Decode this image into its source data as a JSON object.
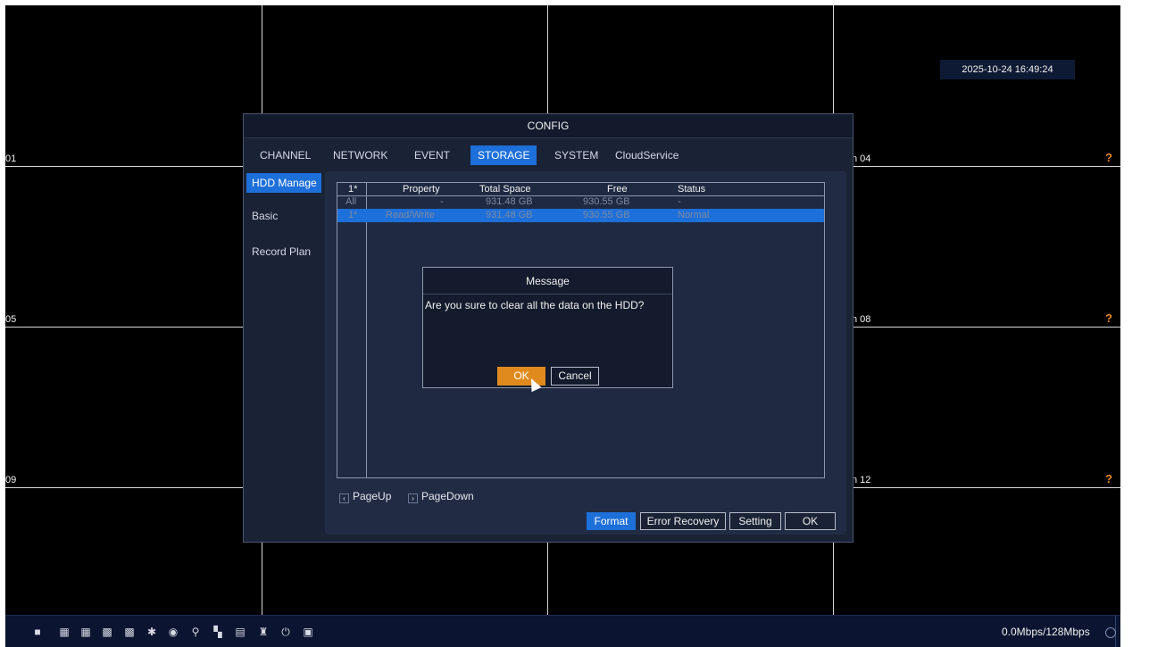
{
  "screen": {
    "clock": "2025-10-24 16:49:24",
    "cameras": [
      {
        "label": "01",
        "status": ""
      },
      {
        "label": "n 04",
        "status": "?"
      },
      {
        "label": "05",
        "status": ""
      },
      {
        "label": "n 08",
        "status": "?"
      },
      {
        "label": "09",
        "status": ""
      },
      {
        "label": "n 12",
        "status": "?"
      }
    ]
  },
  "config": {
    "title": "CONFIG",
    "tabs": [
      "CHANNEL",
      "NETWORK",
      "EVENT",
      "STORAGE",
      "SYSTEM",
      "CloudService"
    ],
    "active_tab": "STORAGE",
    "sidebar": [
      "HDD Manage",
      "Basic",
      "Record Plan"
    ],
    "active_sidebar": "HDD Manage",
    "table": {
      "headers": [
        "1*",
        "Property",
        "Total Space",
        "Free",
        "Status"
      ],
      "rows": [
        [
          "All",
          "-",
          "931.48 GB",
          "930.55 GB",
          "-"
        ],
        [
          "1*",
          "Read/Write",
          "931.48 GB",
          "930.55 GB",
          "Normal"
        ]
      ]
    },
    "pager": {
      "prev": "PageUp",
      "next": "PageDown"
    },
    "buttons": {
      "format": "Format",
      "error_recovery": "Error Recovery",
      "setting": "Setting",
      "ok": "OK"
    }
  },
  "message": {
    "title": "Message",
    "text": "Are you sure to clear all the data on the HDD?",
    "ok": "OK",
    "cancel": "Cancel"
  },
  "taskbar": {
    "icons": [
      "single-view-icon",
      "quad-view-icon",
      "nine-view-icon",
      "sixteen-view-icon",
      "patrol-icon",
      "playback-icon",
      "search-icon",
      "record-icon",
      "config-icon",
      "alarm-icon",
      "power-icon",
      "info-icon"
    ],
    "bandwidth": "0.0Mbps/128Mbps",
    "accent": "#1d6fd9",
    "warn": "#e08a1e"
  }
}
